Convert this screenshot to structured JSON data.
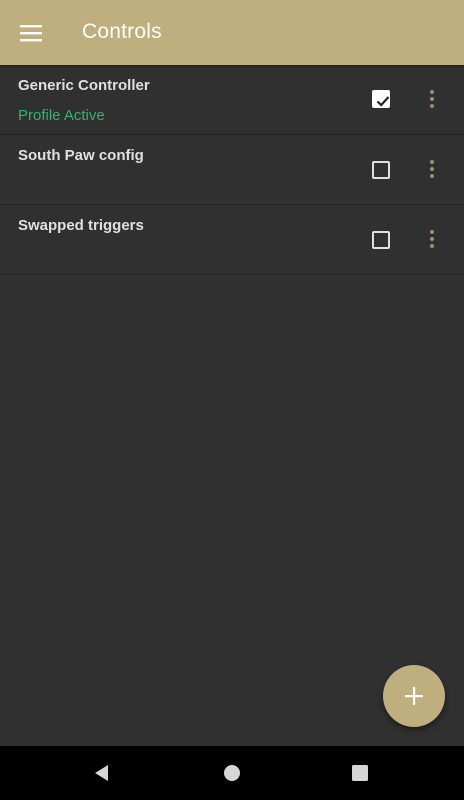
{
  "app_bar": {
    "title": "Controls",
    "background_color": "#bfae7e",
    "menu_icon": "hamburger-menu-icon"
  },
  "profiles": [
    {
      "name": "Generic Controller",
      "status": "Profile Active",
      "checked": true
    },
    {
      "name": "South Paw config",
      "status": "",
      "checked": false
    },
    {
      "name": "Swapped triggers",
      "status": "",
      "checked": false
    }
  ],
  "colors": {
    "background": "#303030",
    "active_status": "#35b26b",
    "accent": "#bfae7e"
  },
  "fab": {
    "icon": "plus-icon"
  },
  "nav_bar": {
    "buttons": [
      "back-icon",
      "home-icon",
      "recents-icon"
    ]
  }
}
